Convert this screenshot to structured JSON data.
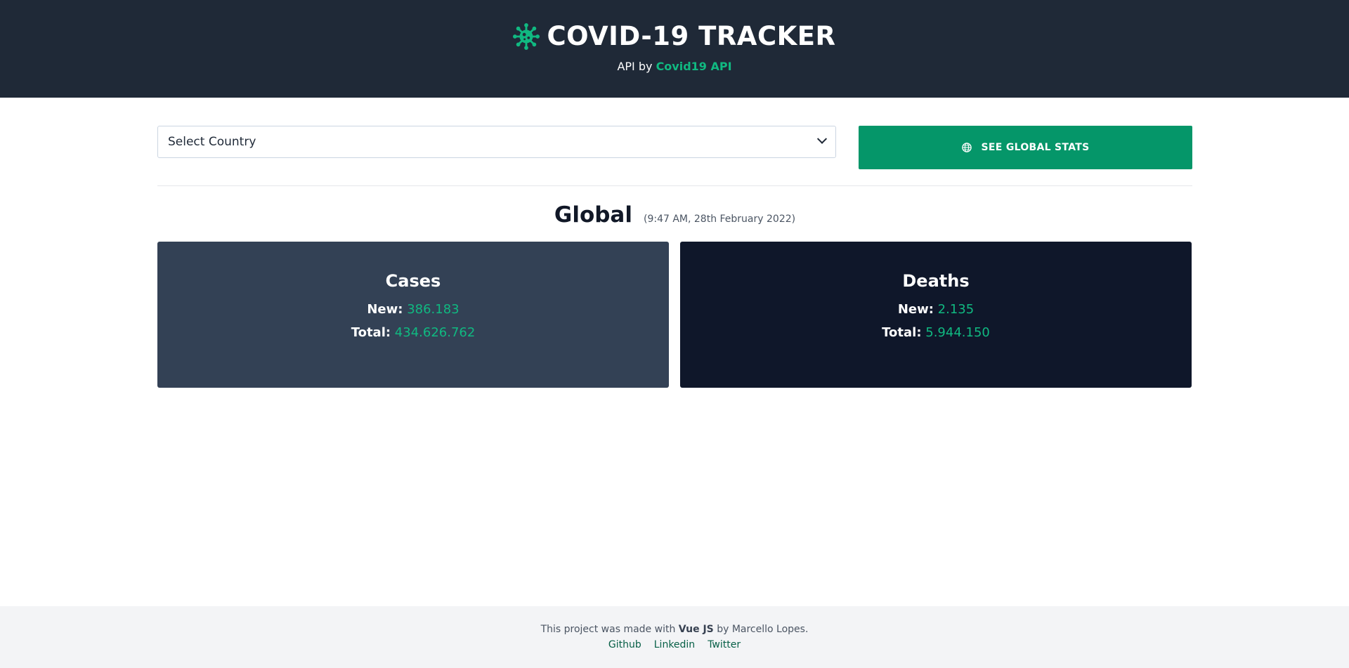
{
  "header": {
    "title": "COVID-19 TRACKER",
    "subtitle_prefix": "API by",
    "api_link": "Covid19 API",
    "logo_icon": "virus-icon"
  },
  "controls": {
    "country_select_value": "Select Country",
    "global_button_label": "SEE GLOBAL STATS",
    "global_button_icon": "globe-icon"
  },
  "section": {
    "title": "Global",
    "timestamp": "(9:47 AM, 28th February 2022)"
  },
  "cards": {
    "cases": {
      "title": "Cases",
      "new_label": "New:",
      "new_value": "386.183",
      "total_label": "Total:",
      "total_value": "434.626.762"
    },
    "deaths": {
      "title": "Deaths",
      "new_label": "New:",
      "new_value": "2.135",
      "total_label": "Total:",
      "total_value": "5.944.150"
    }
  },
  "footer": {
    "text_prefix": "This project was made with",
    "framework": "Vue JS",
    "text_suffix": "by Marcello Lopes.",
    "links": [
      "Github",
      "Linkedin",
      "Twitter"
    ]
  },
  "colors": {
    "header_bg": "#1f2937",
    "accent": "#10b981",
    "button_bg": "#059669",
    "cases_bg": "#334155",
    "deaths_bg": "#0f172a"
  }
}
